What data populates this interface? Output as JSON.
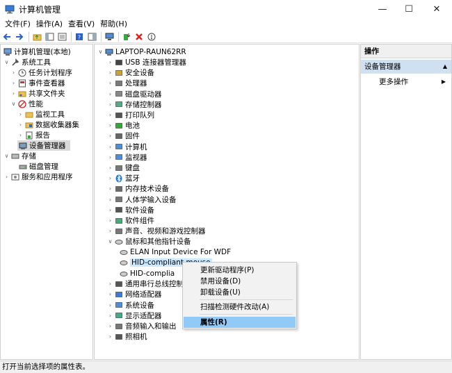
{
  "window": {
    "title": "计算机管理"
  },
  "menubar": [
    "文件(F)",
    "操作(A)",
    "查看(V)",
    "帮助(H)"
  ],
  "toolbar": [
    "back-icon",
    "forward-icon",
    "up-folder-icon",
    "show-hide-tree-icon",
    "export-list-icon",
    "help-icon",
    "properties-pane-icon",
    "monitor-icon",
    "update-driver-icon",
    "uninstall-icon",
    "scan-hardware-icon"
  ],
  "left_tree": [
    {
      "label": "计算机管理(本地)",
      "icon": "computer-management-icon",
      "level": 0,
      "arrow": ""
    },
    {
      "label": "系统工具",
      "icon": "system-tools-icon",
      "level": 1,
      "arrow": "expanded"
    },
    {
      "label": "任务计划程序",
      "icon": "task-scheduler-icon",
      "level": 2,
      "arrow": "collapsed"
    },
    {
      "label": "事件查看器",
      "icon": "event-viewer-icon",
      "level": 2,
      "arrow": "collapsed"
    },
    {
      "label": "共享文件夹",
      "icon": "shared-folders-icon",
      "level": 2,
      "arrow": "collapsed"
    },
    {
      "label": "性能",
      "icon": "performance-icon",
      "level": 2,
      "arrow": "expanded"
    },
    {
      "label": "监视工具",
      "icon": "monitoring-tools-icon",
      "level": 3,
      "arrow": "collapsed"
    },
    {
      "label": "数据收集器集",
      "icon": "data-collector-icon",
      "level": 3,
      "arrow": "collapsed"
    },
    {
      "label": "报告",
      "icon": "reports-icon",
      "level": 3,
      "arrow": "collapsed"
    },
    {
      "label": "设备管理器",
      "icon": "device-manager-icon",
      "level": 2,
      "arrow": "",
      "selected": true
    },
    {
      "label": "存储",
      "icon": "storage-icon",
      "level": 1,
      "arrow": "expanded"
    },
    {
      "label": "磁盘管理",
      "icon": "disk-management-icon",
      "level": 2,
      "arrow": ""
    },
    {
      "label": "服务和应用程序",
      "icon": "services-apps-icon",
      "level": 1,
      "arrow": "collapsed"
    }
  ],
  "device_tree": {
    "root": "LAPTOP-RAUN62RR",
    "categories": [
      {
        "label": "USB 连接器管理器",
        "icon": "usb-icon"
      },
      {
        "label": "安全设备",
        "icon": "security-device-icon"
      },
      {
        "label": "处理器",
        "icon": "processor-icon"
      },
      {
        "label": "磁盘驱动器",
        "icon": "disk-drive-icon"
      },
      {
        "label": "存储控制器",
        "icon": "storage-controller-icon"
      },
      {
        "label": "打印队列",
        "icon": "printer-icon"
      },
      {
        "label": "电池",
        "icon": "battery-icon"
      },
      {
        "label": "固件",
        "icon": "firmware-icon"
      },
      {
        "label": "计算机",
        "icon": "computer-icon"
      },
      {
        "label": "监视器",
        "icon": "monitor-icon"
      },
      {
        "label": "键盘",
        "icon": "keyboard-icon"
      },
      {
        "label": "蓝牙",
        "icon": "bluetooth-icon"
      },
      {
        "label": "内存技术设备",
        "icon": "memory-icon"
      },
      {
        "label": "人体学输入设备",
        "icon": "hid-icon"
      },
      {
        "label": "软件设备",
        "icon": "software-device-icon"
      },
      {
        "label": "软件组件",
        "icon": "software-component-icon"
      },
      {
        "label": "声音、视频和游戏控制器",
        "icon": "sound-icon"
      },
      {
        "label": "鼠标和其他指针设备",
        "icon": "mouse-icon",
        "expanded": true
      },
      {
        "label": "ELAN Input Device For WDF",
        "icon": "mouse-icon",
        "child": true
      },
      {
        "label": "HID-compliant mouse",
        "icon": "mouse-icon",
        "child": true,
        "highlighted": true
      },
      {
        "label": "HID-complia",
        "icon": "mouse-icon",
        "child": true
      },
      {
        "label": "通用串行总线控制",
        "icon": "usb-controller-icon"
      },
      {
        "label": "网络适配器",
        "icon": "network-adapter-icon"
      },
      {
        "label": "系统设备",
        "icon": "system-device-icon"
      },
      {
        "label": "显示适配器",
        "icon": "display-adapter-icon"
      },
      {
        "label": "音频输入和输出",
        "icon": "audio-io-icon"
      },
      {
        "label": "照相机",
        "icon": "camera-icon"
      }
    ]
  },
  "actions_pane": {
    "header": "操作",
    "group": "设备管理器",
    "more": "更多操作"
  },
  "context_menu": [
    {
      "label": "更新驱动程序(P)"
    },
    {
      "label": "禁用设备(D)"
    },
    {
      "label": "卸载设备(U)"
    },
    {
      "label": "扫描检测硬件改动(A)"
    },
    {
      "label": "属性(R)",
      "active": true
    }
  ],
  "statusbar": {
    "text": "打开当前选择项的属性表。"
  }
}
